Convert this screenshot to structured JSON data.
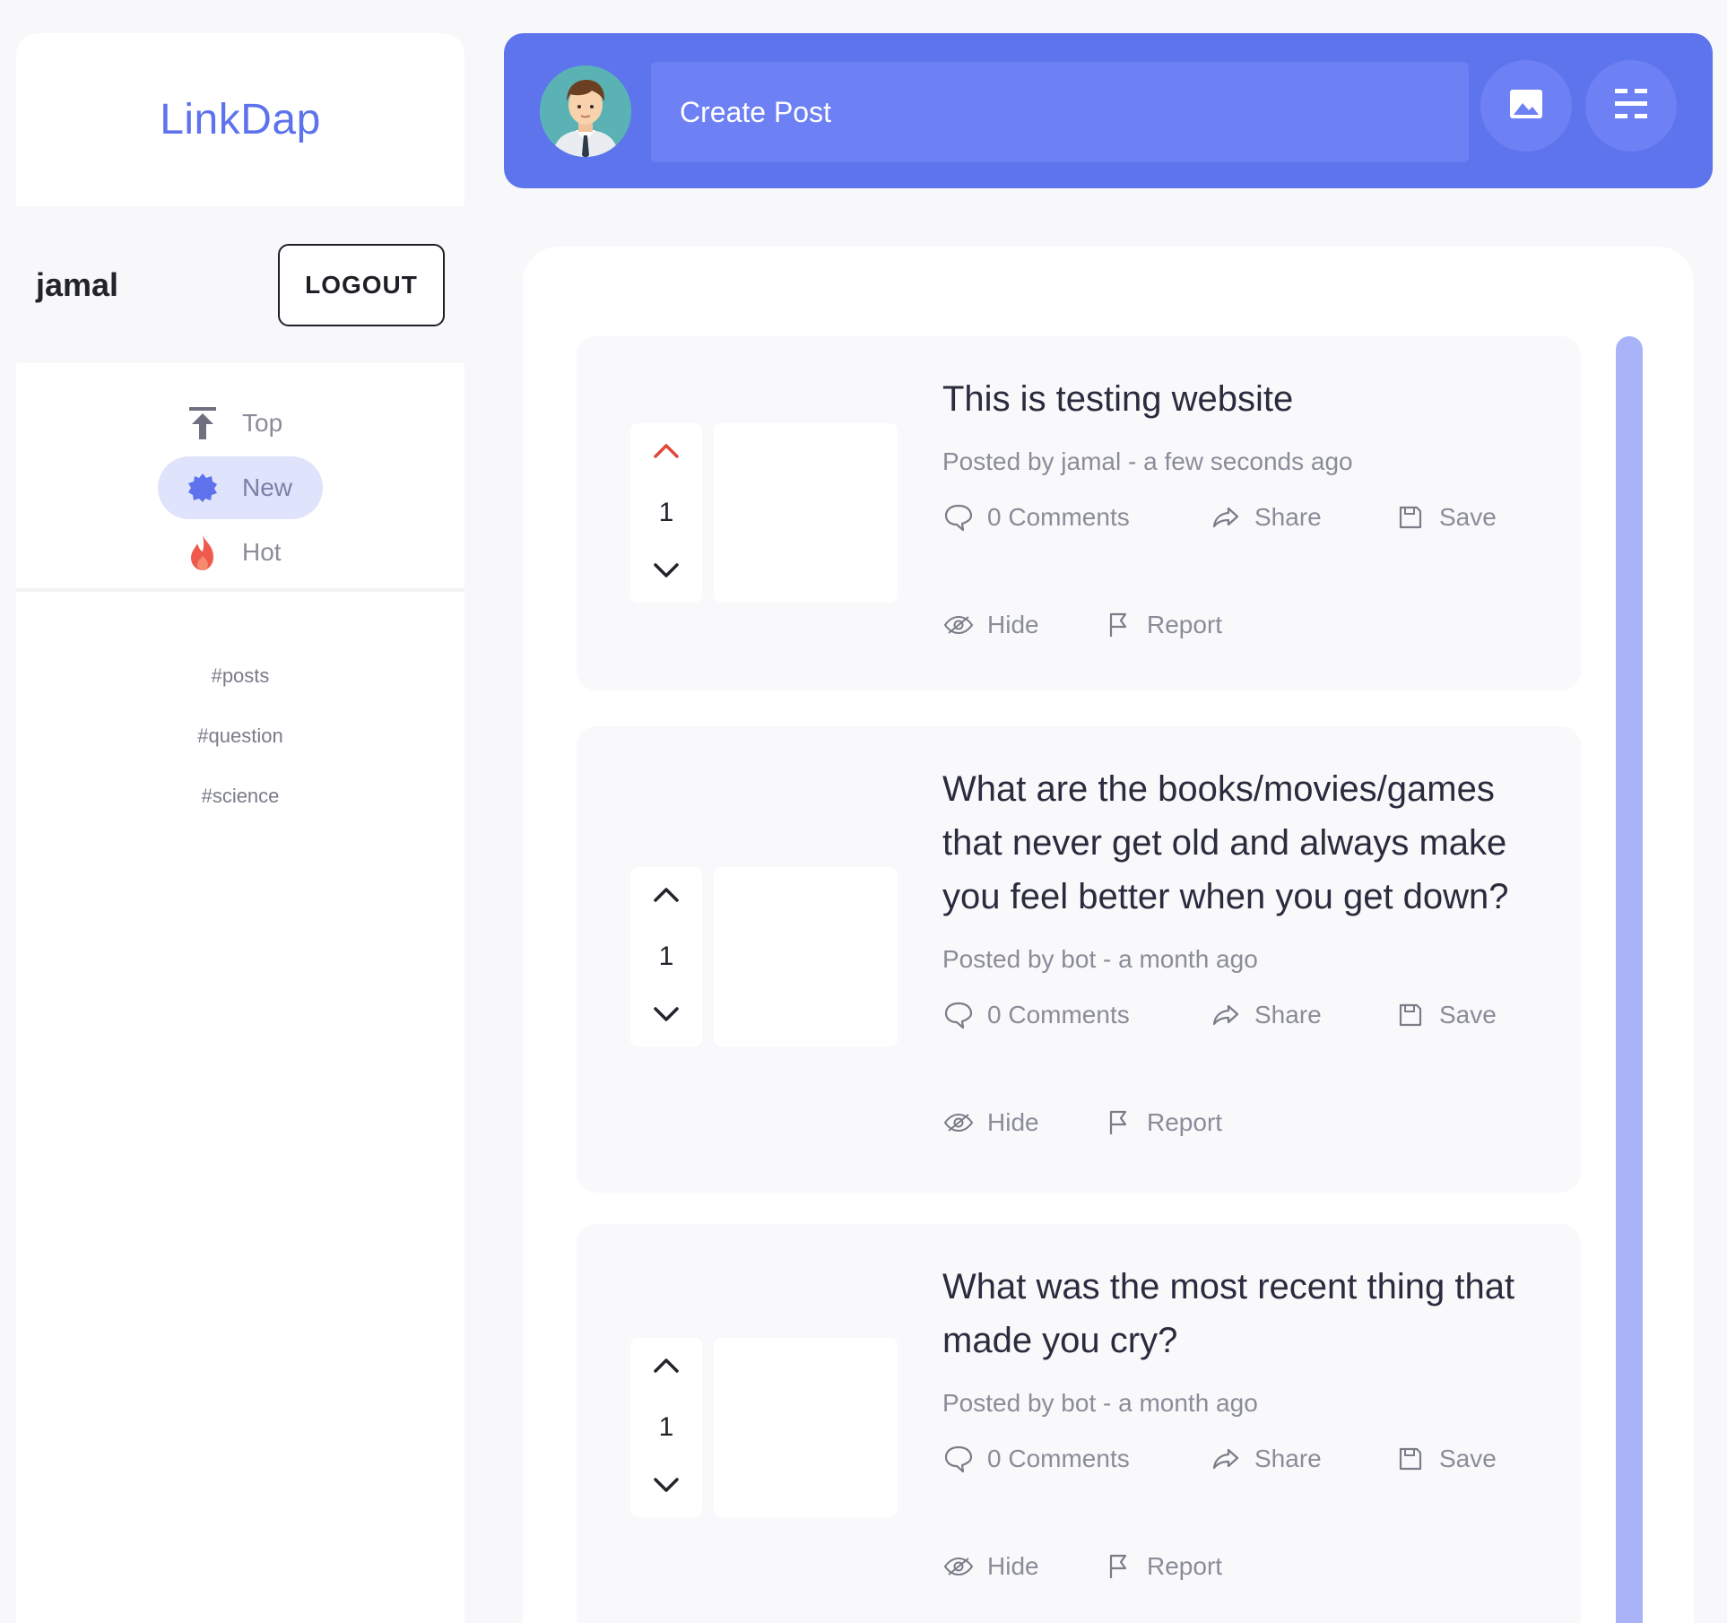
{
  "app": {
    "name": "LinkDap"
  },
  "user": {
    "name": "jamal",
    "logout_label": "LOGOUT"
  },
  "nav": {
    "items": [
      {
        "label": "Top",
        "icon": "arrow-to-top-icon",
        "active": false
      },
      {
        "label": "New",
        "icon": "new-badge-icon",
        "active": true
      },
      {
        "label": "Hot",
        "icon": "flame-icon",
        "active": false
      }
    ]
  },
  "tags": [
    "#posts",
    "#question",
    "#science"
  ],
  "topbar": {
    "create_post_label": "Create Post",
    "image_icon": "image-icon",
    "menu_icon": "menu-icon"
  },
  "colors": {
    "accent": "#5d74ed",
    "upvote_active": "#e0463a",
    "scrollbar": "#a9b3f8"
  },
  "posts": [
    {
      "title": "This is testing website",
      "meta": "Posted by jamal - a few seconds ago",
      "votes": "1",
      "upvoted": true,
      "comments_label": "0 Comments",
      "share_label": "Share",
      "save_label": "Save",
      "hide_label": "Hide",
      "report_label": "Report"
    },
    {
      "title": "What are the books/movies/games that never get old and always make you feel better when you get down?",
      "meta": "Posted by bot - a month ago",
      "votes": "1",
      "upvoted": false,
      "comments_label": "0 Comments",
      "share_label": "Share",
      "save_label": "Save",
      "hide_label": "Hide",
      "report_label": "Report"
    },
    {
      "title": "What was the most recent thing that made you cry?",
      "meta": "Posted by bot - a month ago",
      "votes": "1",
      "upvoted": false,
      "comments_label": "0 Comments",
      "share_label": "Share",
      "save_label": "Save",
      "hide_label": "Hide",
      "report_label": "Report"
    }
  ]
}
